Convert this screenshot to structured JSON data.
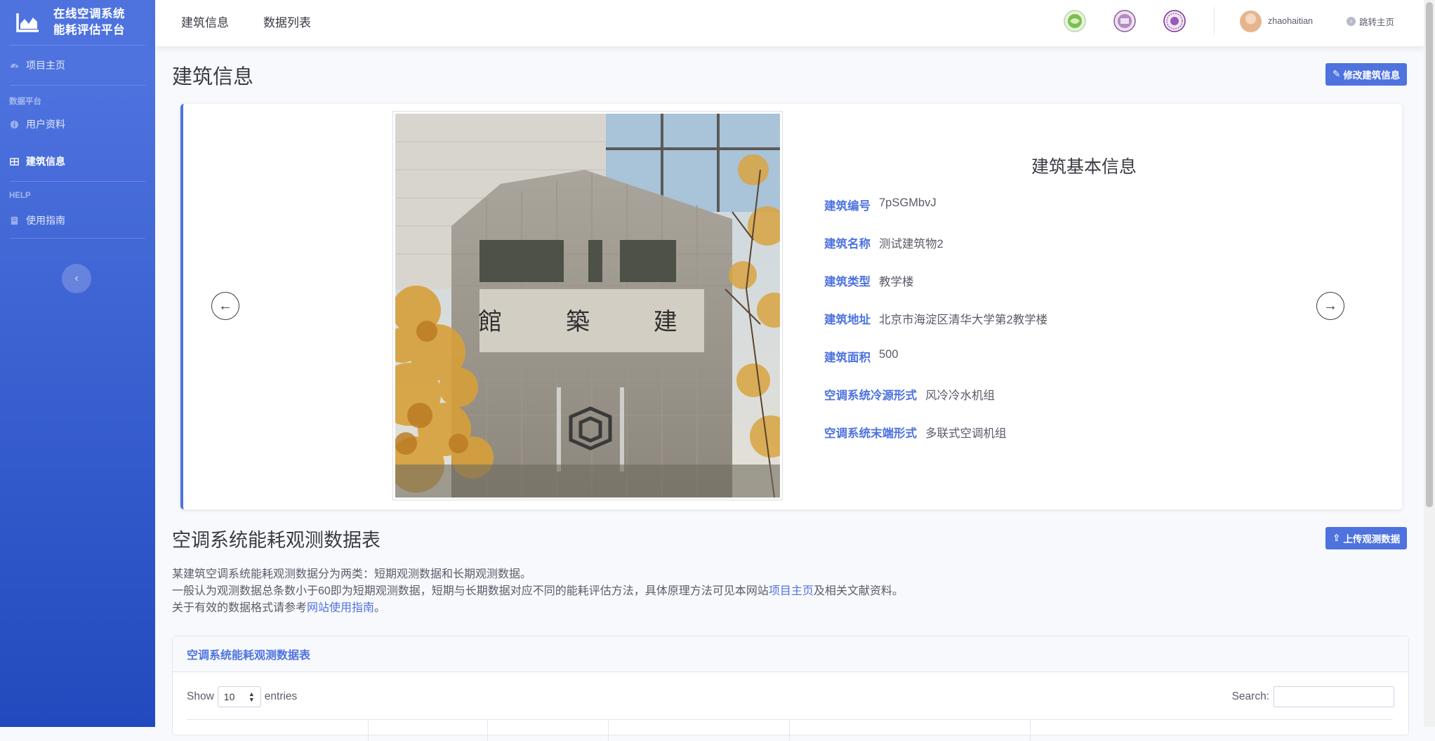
{
  "sidebar": {
    "brand_line1": "在线空调系统",
    "brand_line2": "能耗评估平台",
    "items": [
      {
        "label": "项目主页"
      },
      {
        "label": "用户资料"
      },
      {
        "label": "建筑信息"
      },
      {
        "label": "使用指南"
      }
    ],
    "headings": [
      "数据平台",
      "HELP"
    ]
  },
  "topbar": {
    "nav": [
      "建筑信息",
      "数据列表"
    ],
    "username": "zhaohaitian",
    "jump_label": "跳转主页"
  },
  "page": {
    "title": "建筑信息",
    "edit_button": "修改建筑信息"
  },
  "building": {
    "card_title": "建筑基本信息",
    "photo_plaque": "館 築 建",
    "fields": [
      {
        "label": "建筑编号",
        "value": "7pSGMbvJ"
      },
      {
        "label": "建筑名称",
        "value": "测试建筑物2"
      },
      {
        "label": "建筑类型",
        "value": "教学楼"
      },
      {
        "label": "建筑地址",
        "value": "北京市海淀区清华大学第2教学楼"
      },
      {
        "label": "建筑面积",
        "value": "500"
      },
      {
        "label": "空调系统冷源形式",
        "value": "风冷冷水机组"
      },
      {
        "label": "空调系统末端形式",
        "value": "多联式空调机组"
      }
    ]
  },
  "data_section": {
    "title": "空调系统能耗观测数据表",
    "upload_button": "上传观测数据",
    "desc_line1": "某建筑空调系统能耗观测数据分为两类：短期观测数据和长期观测数据。",
    "desc_line2_a": "一般认为观测数据总条数小于60即为短期观测数据，短期与长期数据对应不同的能耗评估方法，具体原理方法可见本网站",
    "desc_line2_link": "项目主页",
    "desc_line2_b": "及相关文献资料。",
    "desc_line3_a": "关于有效的数据格式请参考",
    "desc_line3_link": "网站使用指南",
    "desc_line3_b": "。"
  },
  "table": {
    "header": "空调系统能耗观测数据表",
    "show_label": "Show",
    "entries_value": "10",
    "entries_label": "entries",
    "search_label": "Search:"
  },
  "colors": {
    "primary": "#4e73df",
    "sidebar_dark": "#224abe"
  }
}
